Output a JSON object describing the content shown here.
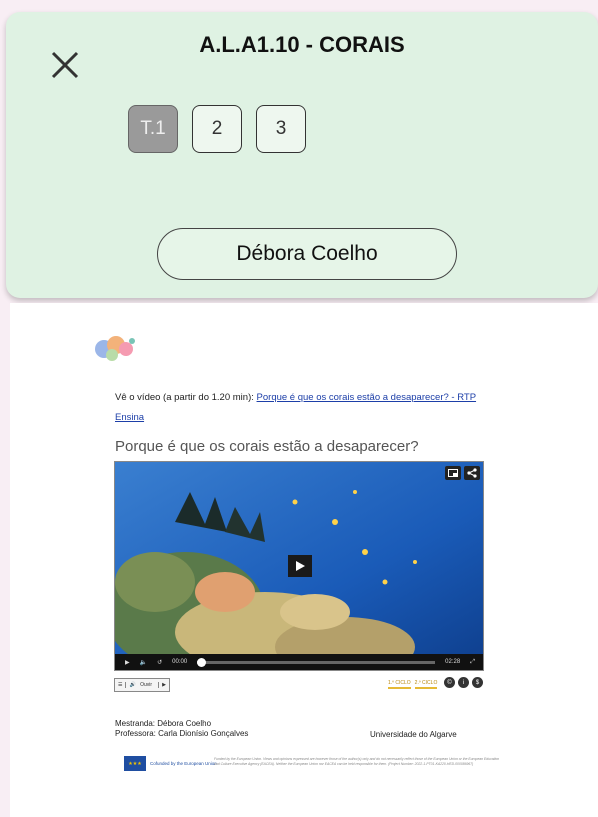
{
  "header": {
    "title": "A.L.A1.10 - CORAIS",
    "close_icon": "close-icon",
    "tabs": [
      {
        "label": "T.1",
        "active": true
      },
      {
        "label": "2",
        "active": false
      },
      {
        "label": "3",
        "active": false
      }
    ],
    "student_name": "Débora Coelho"
  },
  "document": {
    "intro_text": "Vê o vídeo (a partir do 1.20 min): ",
    "intro_link": "Porque é que os corais estão a desaparecer? - RTP Ensina",
    "video_title": "Porque é que os corais estão a desaparecer?",
    "video": {
      "current_time": "00:00",
      "duration": "02:28",
      "progress": 0,
      "play_icon": "play-icon",
      "volume_icon": "volume-icon",
      "replay_icon": "replay-icon",
      "fullscreen_icon": "fullscreen-icon",
      "pip_icon": "picture-in-picture-icon",
      "share_icon": "share-icon"
    },
    "below_video": {
      "listen_label": "Ouvir",
      "cycles": [
        "1.º CICLO",
        "2.º CICLO"
      ]
    },
    "footer": {
      "mestranda": "Mestranda: Débora Coelho",
      "professora": "Professora: Carla Dionísio Gonçalves",
      "university": "Universidade do Algarve",
      "eu_text": "Cofunded by the European Union",
      "disclaimer": "Funded by the European Union. Views and opinions expressed are however those of the author(s) only and do not necessarily reflect those of the European Union or the European Education and Culture Executive Agency (EACEA). Neither the European Union nor EACEA can be held responsible for them. (Project Number: 2022-1-PT01-KA220-HED-000086967)"
    }
  },
  "colors": {
    "page_background": "#f8eef4",
    "panel_background": "#dff2e3",
    "active_tab": "#9a9a9a",
    "link": "#1d3fa8"
  }
}
